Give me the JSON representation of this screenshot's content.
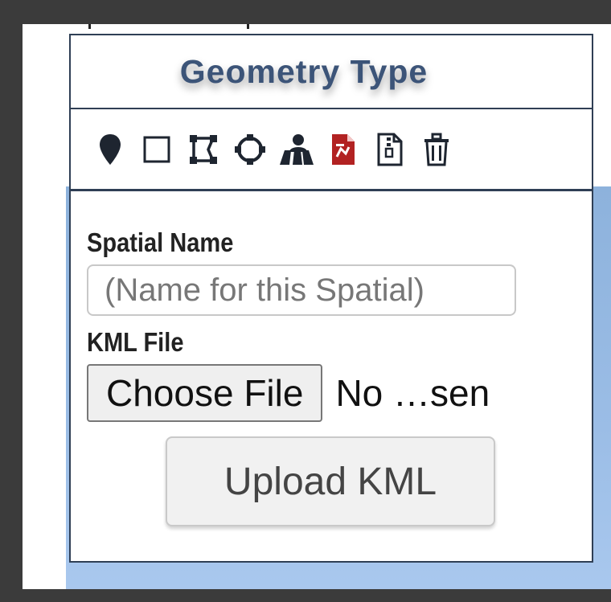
{
  "panel": {
    "title": "Geometry Type"
  },
  "toolbar": {
    "icons": [
      {
        "name": "marker-icon"
      },
      {
        "name": "rectangle-icon"
      },
      {
        "name": "polygon-icon"
      },
      {
        "name": "circle-icon"
      },
      {
        "name": "map-user-icon"
      },
      {
        "name": "kml-file-icon",
        "color": "#b22222"
      },
      {
        "name": "file-zipper-icon"
      },
      {
        "name": "trash-icon"
      }
    ]
  },
  "form": {
    "spatial_name_label": "Spatial Name",
    "spatial_name_placeholder": "(Name for this Spatial)",
    "spatial_name_value": "",
    "kml_file_label": "KML File",
    "choose_file_label": "Choose File",
    "file_status": "No …sen",
    "upload_label": "Upload KML"
  },
  "colors": {
    "panel_border": "#2f3f55",
    "title": "#3c5478",
    "map_blue": "#9bbde6",
    "kml_icon": "#b22222"
  }
}
